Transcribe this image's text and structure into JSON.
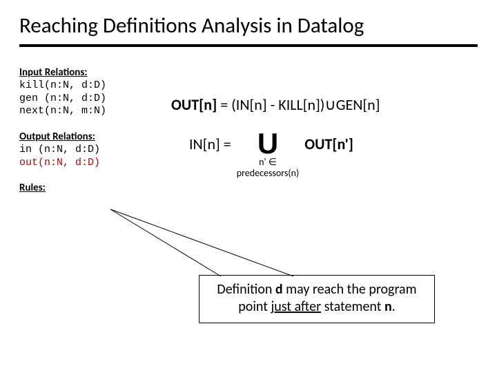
{
  "title": "Reaching Definitions Analysis in Datalog",
  "left": {
    "input_title": "Input Relations:",
    "input_lines": "kill(n:N, d:D)\ngen (n:N, d:D)\nnext(n:N, m:N)",
    "output_title": "Output Relations:",
    "output_line1": "in (n:N, d:D)",
    "output_line2": "out(n:N, d:D)",
    "rules_title": "Rules:"
  },
  "eq1": {
    "lhs": "OUT[n]",
    "eq": "  =  ",
    "rhs1": "(IN[n] - KILL[n])",
    "cup": " ∪ ",
    "rhs2": "GEN[n]"
  },
  "eq2": {
    "lhs": "IN[n]  =",
    "bigU": "U",
    "sub1": "n' ∈",
    "sub2": "predecessors(n)",
    "rhs": "OUT[n']"
  },
  "note": {
    "pre": "Definition ",
    "d": "d",
    "mid": " may reach the program point ",
    "after": "just after",
    "post1": " statement ",
    "n": "n",
    "post2": "."
  }
}
